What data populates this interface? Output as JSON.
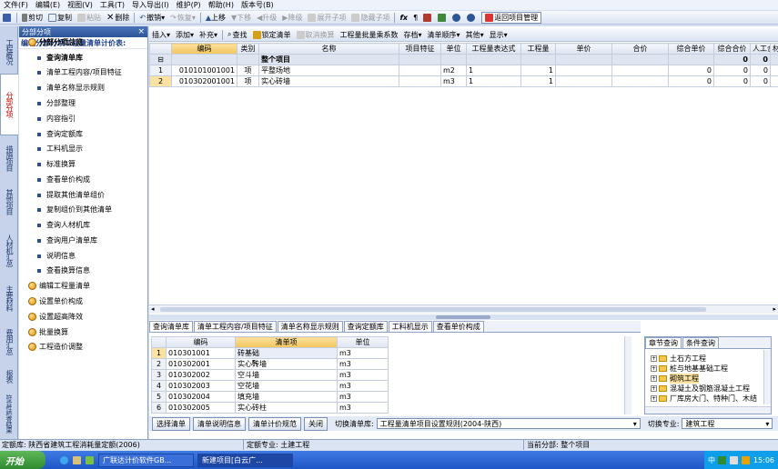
{
  "menu": [
    "文件(F)",
    "编辑(E)",
    "视图(V)",
    "工具(T)",
    "导入导出(I)",
    "维护(P)",
    "帮助(H)",
    "版本号(B)"
  ],
  "toolbar1": {
    "cut": "剪切",
    "copy": "复制",
    "paste": "粘贴",
    "delete": "删除",
    "undo": "撤销",
    "redo": "恢复",
    "up": "上移",
    "down": "下移",
    "promote": "升级",
    "demote": "降级",
    "expand": "展开子项",
    "collapse": "隐藏子项",
    "return_btn": "返回项目管理"
  },
  "left_tabs": [
    "工程概况",
    "分部分项",
    "措施项目",
    "其他项目",
    "人材机汇总",
    "主要材料",
    "费用汇总",
    "报表",
    "符合性检查结果"
  ],
  "nav": {
    "header": "分部分项",
    "close": "×",
    "subtitle": "编制分部分项工程量清单计价表:",
    "items": [
      {
        "label": "分部分项总览",
        "type": "main"
      },
      {
        "label": "查询清单库",
        "type": "sub",
        "bold": true
      },
      {
        "label": "清单工程内容/项目特征",
        "type": "sub"
      },
      {
        "label": "清单名称显示规则",
        "type": "sub"
      },
      {
        "label": "分部整理",
        "type": "sub"
      },
      {
        "label": "内容指引",
        "type": "sub"
      },
      {
        "label": "查询定额库",
        "type": "sub"
      },
      {
        "label": "工料机显示",
        "type": "sub"
      },
      {
        "label": "标准换算",
        "type": "sub"
      },
      {
        "label": "查看单价构成",
        "type": "sub"
      },
      {
        "label": "提取其他清单组价",
        "type": "sub"
      },
      {
        "label": "复制组价到其他清单",
        "type": "sub"
      },
      {
        "label": "查询人材机库",
        "type": "sub"
      },
      {
        "label": "查询用户清单库",
        "type": "sub"
      },
      {
        "label": "说明信息",
        "type": "sub"
      },
      {
        "label": "查看换算信息",
        "type": "sub"
      },
      {
        "label": "编辑工程量清单",
        "type": "main"
      },
      {
        "label": "设置单价构成",
        "type": "main"
      },
      {
        "label": "设置超高降效",
        "type": "main"
      },
      {
        "label": "批量换算",
        "type": "main"
      },
      {
        "label": "工程造价调整",
        "type": "main"
      }
    ]
  },
  "toolbar2": [
    "插入",
    "添加",
    "补充",
    "查找",
    "锁定清单",
    "取消换算",
    "工程量批量乘系数",
    "存档",
    "清单顺序",
    "其他",
    "显示"
  ],
  "grid": {
    "headers": [
      "",
      "编码",
      "类别",
      "名称",
      "项目特征",
      "单位",
      "工程量表达式",
      "工程量",
      "单价",
      "合价",
      "综合单价",
      "综合合价",
      "人工合价",
      "材"
    ],
    "group_row": {
      "name": "整个项目",
      "v1": "0",
      "v2": "0"
    },
    "rows": [
      {
        "no": "1",
        "code": "010101001001",
        "type": "项",
        "name": "平整场地",
        "unit": "m2",
        "expr": "1",
        "qty": "1",
        "zhdj": "0",
        "zhhj": "0",
        "rghj": "0"
      },
      {
        "no": "2",
        "code": "010302001001",
        "type": "项",
        "name": "实心砖墙",
        "unit": "m3",
        "expr": "1",
        "qty": "1",
        "zhdj": "0",
        "zhhj": "0",
        "rghj": "0"
      }
    ]
  },
  "bottom_tabs": [
    "查询清单库",
    "清单工程内容/项目特征",
    "清单名称显示规则",
    "查询定额库",
    "工料机显示",
    "查看单价构成"
  ],
  "bottom_grid": {
    "headers": [
      "",
      "编码",
      "清单项",
      "单位"
    ],
    "rows": [
      {
        "no": "1",
        "code": "010301001",
        "name": "砖基础",
        "unit": "m3"
      },
      {
        "no": "2",
        "code": "010302001",
        "name": "实心砖墙",
        "unit": "m3"
      },
      {
        "no": "3",
        "code": "010302002",
        "name": "空斗墙",
        "unit": "m3"
      },
      {
        "no": "4",
        "code": "010302003",
        "name": "空花墙",
        "unit": "m3"
      },
      {
        "no": "5",
        "code": "010302004",
        "name": "填充墙",
        "unit": "m3"
      },
      {
        "no": "6",
        "code": "010302005",
        "name": "实心砖柱",
        "unit": "m3"
      }
    ]
  },
  "right_panel": {
    "tabs": [
      "章节查询",
      "条件查询"
    ],
    "tree": [
      "土石方工程",
      "桩与地基基础工程",
      "砌筑工程",
      "混凝土及钢筋混凝土工程",
      "厂库房大门、特种门、木结"
    ]
  },
  "bottom_buttons": [
    "选择清单",
    "清单说明信息",
    "清单计价规范",
    "关闭"
  ],
  "switch_lib": {
    "label": "切换清单库:",
    "value": "工程量清单项目设置规则(2004-陕西)"
  },
  "switch_spec": {
    "label": "切换专业:",
    "value": "建筑工程"
  },
  "status": {
    "quota_lib": "定额库: 陕西省建筑工程消耗量定额(2006)",
    "quota_spec": "定额专业: 土建工程",
    "current": "当前分部: 整个项目"
  },
  "taskbar": {
    "start": "开始",
    "tasks": [
      "广联达计价软件GB...",
      "新建项目[白云广..."
    ],
    "ime": "中",
    "time": "15:06"
  }
}
